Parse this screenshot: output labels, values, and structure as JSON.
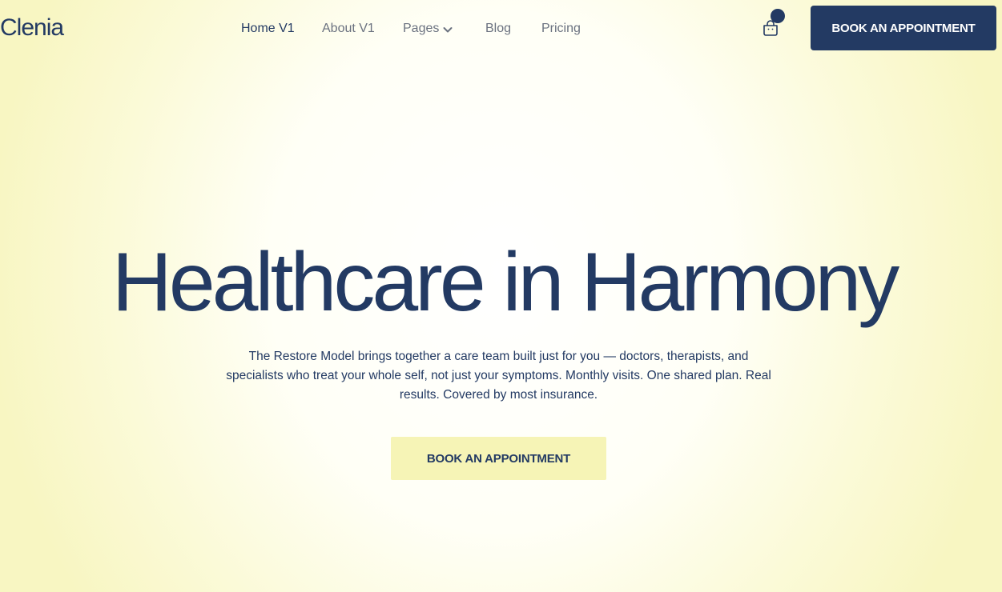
{
  "header": {
    "logo": "Clenia",
    "nav": [
      {
        "label": "Home V1"
      },
      {
        "label": "About V1"
      },
      {
        "label": "Pages"
      },
      {
        "label": "Blog"
      },
      {
        "label": "Pricing"
      }
    ],
    "cta_label": "BOOK AN APPOINTMENT"
  },
  "hero": {
    "title": "Healthcare in Harmony",
    "subtitle": "The Restore Model brings together a care team built just for you — doctors, therapists, and specialists who treat your whole self, not just your symptoms. Monthly visits. One shared plan. Real results. Covered by most insurance.",
    "cta_label": "BOOK AN APPOINTMENT"
  },
  "colors": {
    "brand": "#233a63",
    "accent_yellow": "#f6f4b6",
    "background": "#f8f6c2"
  },
  "icons": [
    "shopping-bag-icon",
    "chevron-down-icon"
  ]
}
